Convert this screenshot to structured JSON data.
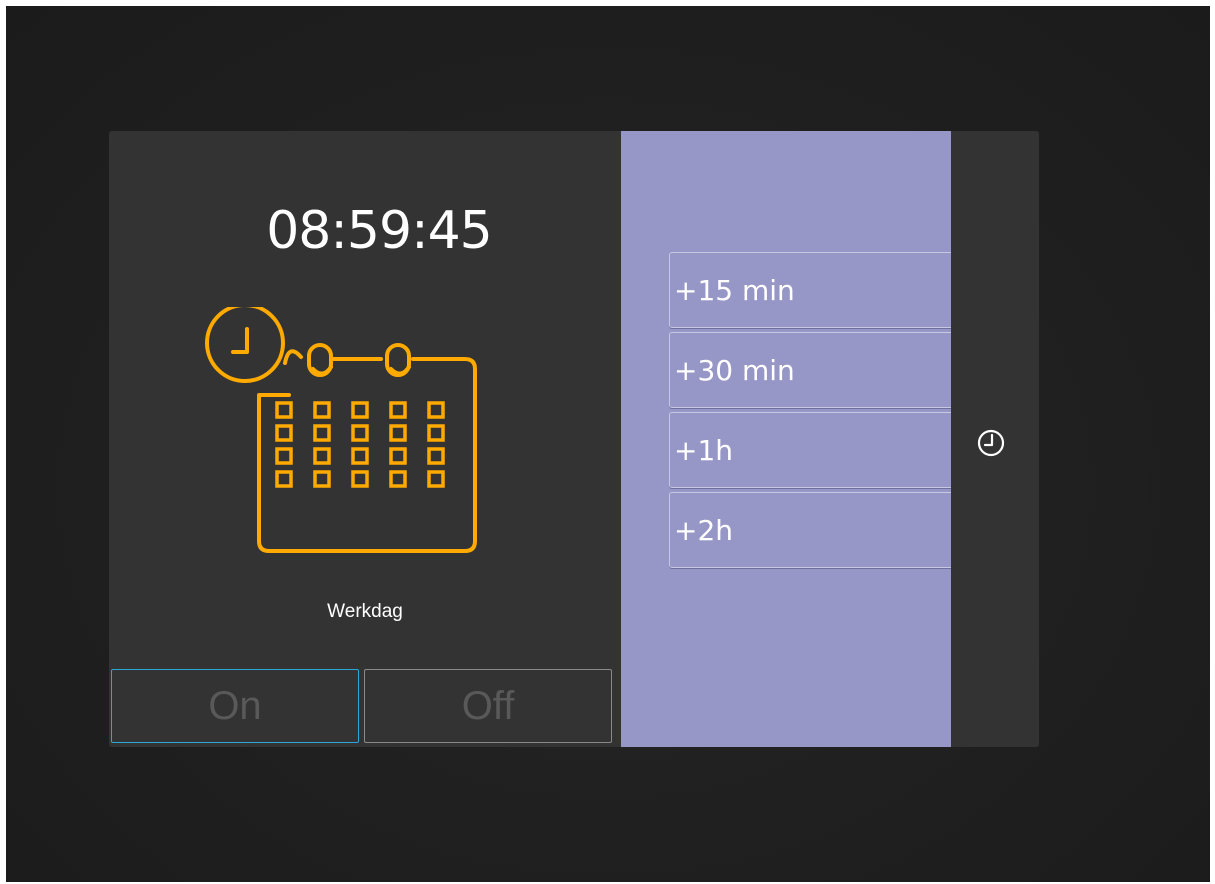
{
  "clock": {
    "time": "08:59:45"
  },
  "schedule": {
    "icon": "calendar-clock-icon",
    "label": "Werkdag",
    "icon_color": "#ffaa00"
  },
  "toggle": {
    "on_label": "On",
    "off_label": "Off",
    "active": "On",
    "active_border_color": "#2aa9d8"
  },
  "snooze_options": [
    {
      "label": "+15 min"
    },
    {
      "label": "+30 min"
    },
    {
      "label": "+1h"
    },
    {
      "label": "+2h"
    }
  ],
  "side_strip": {
    "icon": "clock-icon"
  },
  "colors": {
    "background": "#1f1f1f",
    "panel": "#333333",
    "accent_panel": "#9797c7",
    "text": "#ffffff"
  }
}
